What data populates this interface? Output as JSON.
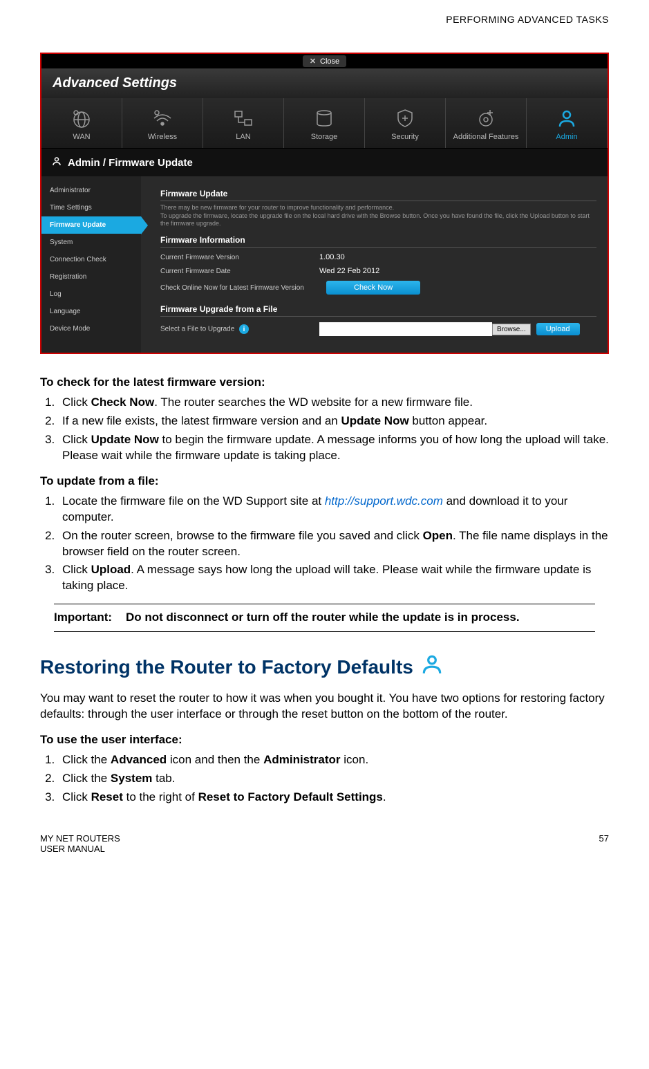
{
  "header": {
    "section_title": "PERFORMING ADVANCED TASKS"
  },
  "screenshot": {
    "close_label": "Close",
    "window_title": "Advanced Settings",
    "nav": [
      {
        "label": "WAN"
      },
      {
        "label": "Wireless"
      },
      {
        "label": "LAN"
      },
      {
        "label": "Storage"
      },
      {
        "label": "Security"
      },
      {
        "label": "Additional Features"
      },
      {
        "label": "Admin"
      }
    ],
    "breadcrumb": "Admin / Firmware Update",
    "sidebar": [
      {
        "label": "Administrator"
      },
      {
        "label": "Time Settings"
      },
      {
        "label": "Firmware Update"
      },
      {
        "label": "System"
      },
      {
        "label": "Connection Check"
      },
      {
        "label": "Registration"
      },
      {
        "label": "Log"
      },
      {
        "label": "Language"
      },
      {
        "label": "Device Mode"
      }
    ],
    "fw_update": {
      "title": "Firmware Update",
      "desc": "There may be new firmware for your router to improve functionality and performance.\nTo upgrade the firmware, locate the upgrade file on the local hard drive with the Browse button. Once you have found the file, click the Upload button to start the firmware upgrade."
    },
    "fw_info": {
      "title": "Firmware Information",
      "version_label": "Current Firmware Version",
      "version_value": "1.00.30",
      "date_label": "Current Firmware Date",
      "date_value": "Wed 22 Feb 2012",
      "check_label": "Check Online Now for Latest Firmware Version",
      "check_btn": "Check Now"
    },
    "fw_file": {
      "title": "Firmware Upgrade from a File",
      "select_label": "Select a File to Upgrade",
      "browse_btn": "Browse...",
      "upload_btn": "Upload"
    }
  },
  "procedures": {
    "check": {
      "title": "To check for the latest firmware version:",
      "steps": {
        "s1_a": "Click ",
        "s1_b": "Check Now",
        "s1_c": ". The router searches the WD website for a new firmware file.",
        "s2_a": "If a new file exists, the latest firmware version and an ",
        "s2_b": "Update Now",
        "s2_c": " button appear.",
        "s3_a": "Click ",
        "s3_b": "Update Now",
        "s3_c": " to begin the firmware update. A message informs you of how long the upload will take. Please wait while the firmware update is taking place."
      }
    },
    "file": {
      "title": "To update from a file:",
      "steps": {
        "s1_a": "Locate the firmware file on the WD Support site at ",
        "s1_link": "http://support.wdc.com",
        "s1_b": " and download it to your computer.",
        "s2_a": "On the router screen, browse to the firmware file you saved and click ",
        "s2_b": "Open",
        "s2_c": ". The file name displays in the browser field on the router screen.",
        "s3_a": "Click ",
        "s3_b": "Upload",
        "s3_c": ". A message says how long the upload will take. Please wait while the firmware update is taking place."
      }
    },
    "important": {
      "label": "Important:",
      "text": "Do not disconnect or turn off the router while the update is in process."
    }
  },
  "restore": {
    "heading": "Restoring the Router to Factory Defaults",
    "intro": "You may want to reset the router to how it was when you bought it. You have two options for restoring factory defaults: through the user interface or through the reset button on the bottom of the router.",
    "ui_proc": {
      "title": "To use the user interface:",
      "steps": {
        "s1_a": "Click the ",
        "s1_b": "Advanced",
        "s1_c": " icon and then the ",
        "s1_d": "Administrator",
        "s1_e": " icon.",
        "s2_a": "Click the ",
        "s2_b": "System",
        "s2_c": " tab.",
        "s3_a": "Click ",
        "s3_b": "Reset",
        "s3_c": " to the right of ",
        "s3_d": "Reset to Factory Default Settings",
        "s3_e": "."
      }
    }
  },
  "footer": {
    "line1": "MY NET ROUTERS",
    "line2": "USER MANUAL",
    "page": "57"
  }
}
